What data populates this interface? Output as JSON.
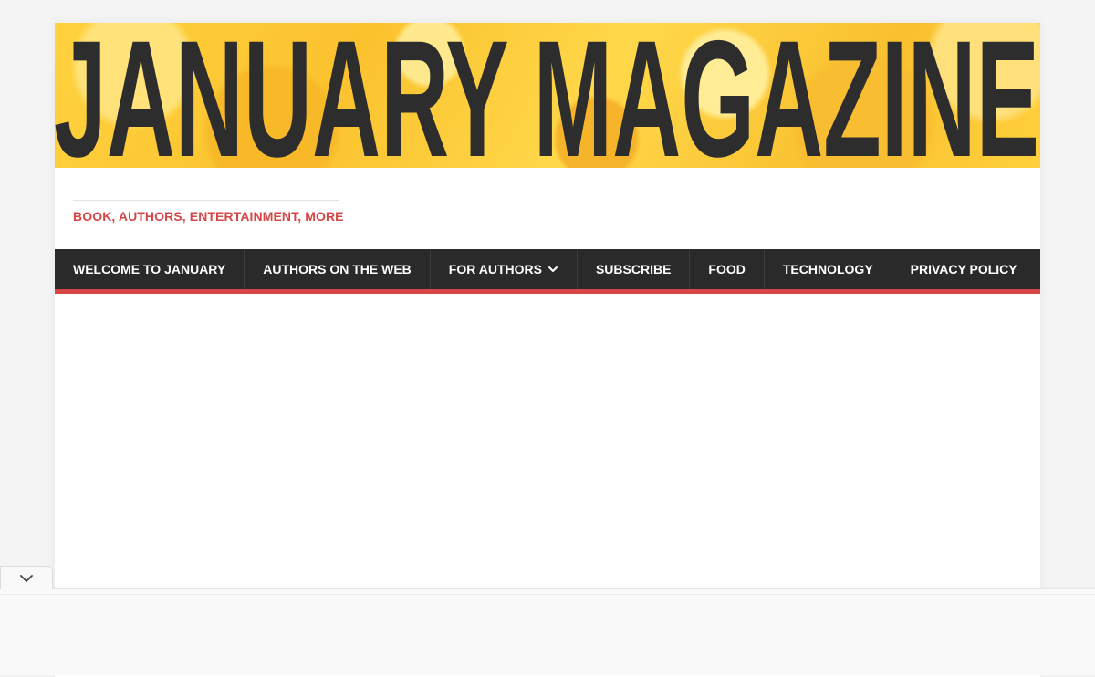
{
  "site": {
    "title": "JANUARY MAGAZINE",
    "tagline": "BOOK, AUTHORS, ENTERTAINMENT, MORE"
  },
  "nav": {
    "items": [
      {
        "label": "WELCOME TO JANUARY"
      },
      {
        "label": "AUTHORS ON THE WEB"
      },
      {
        "label": "FOR AUTHORS",
        "has_dropdown": true
      },
      {
        "label": "SUBSCRIBE"
      },
      {
        "label": "FOOD"
      },
      {
        "label": "TECHNOLOGY"
      },
      {
        "label": "PRIVACY POLICY"
      }
    ]
  },
  "icons": {
    "dropdown": "chevron-down-icon",
    "collapse": "chevron-down-icon"
  },
  "colors": {
    "accent": "#d64646",
    "nav_background": "#2a2a2a",
    "banner_yellow": "#fbc22e",
    "banner_text": "#2d2d2d"
  }
}
